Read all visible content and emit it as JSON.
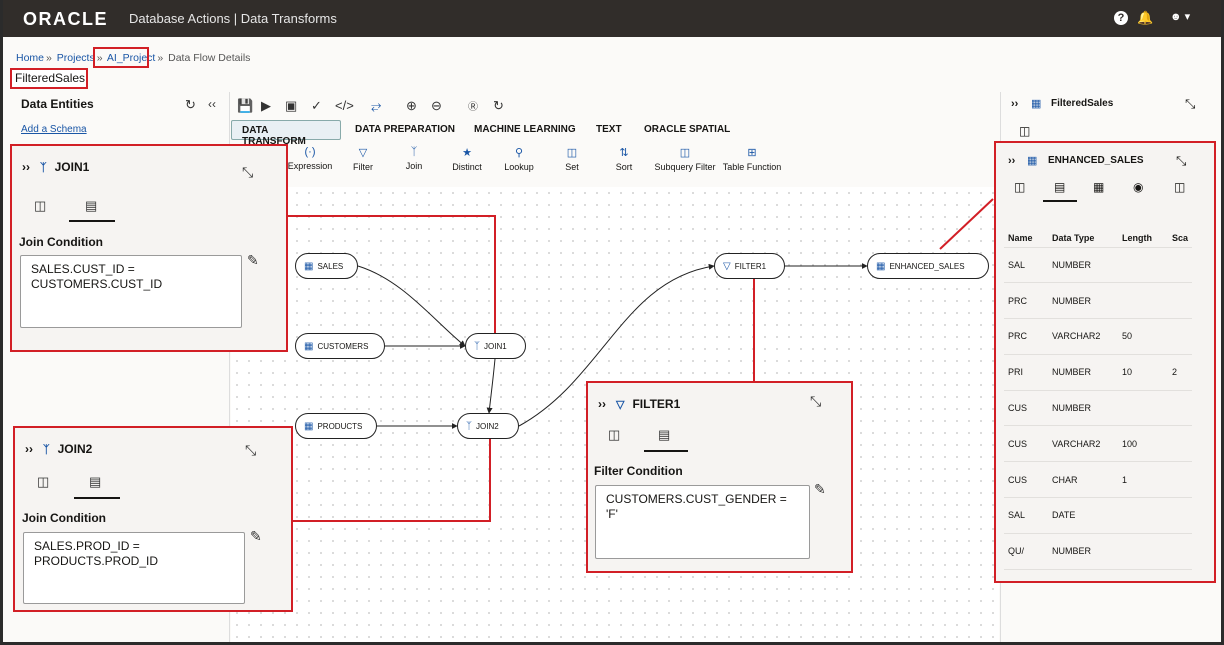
{
  "header": {
    "logo": "ORACLE",
    "app_title": "Database Actions | Data Transforms",
    "help_icon": "?",
    "bell_icon": "bell",
    "user_icon": "user"
  },
  "breadcrumb": {
    "home": "Home",
    "projects": "Projects",
    "project": "AI_Project",
    "current": "Data Flow Details"
  },
  "page_title": "FilteredSales",
  "data_entities": {
    "title": "Data Entities",
    "add_schema": "Add a Schema"
  },
  "tabs": [
    "DATA TRANSFORM",
    "DATA PREPARATION",
    "MACHINE LEARNING",
    "TEXT",
    "ORACLE SPATIAL"
  ],
  "tools": [
    "Expression",
    "Filter",
    "Join",
    "Distinct",
    "Lookup",
    "Set",
    "Sort",
    "Subquery Filter",
    "Table Function"
  ],
  "nodes": {
    "sales": "SALES",
    "customers": "CUSTOMERS",
    "products": "PRODUCTS",
    "join1": "JOIN1",
    "join2": "JOIN2",
    "filter1": "FILTER1",
    "enhanced": "ENHANCED_SALES"
  },
  "right_panel": {
    "title": "FilteredSales"
  },
  "join1": {
    "title": "JOIN1",
    "label": "Join Condition",
    "condition": "SALES.CUST_ID =\nCUSTOMERS.CUST_ID"
  },
  "join2": {
    "title": "JOIN2",
    "label": "Join Condition",
    "condition": "SALES.PROD_ID =\nPRODUCTS.PROD_ID"
  },
  "filter1": {
    "title": "FILTER1",
    "label": "Filter Condition",
    "condition": "CUSTOMERS.CUST_GENDER =\n'F'"
  },
  "enhanced_sales": {
    "title": "ENHANCED_SALES",
    "headers": [
      "Name",
      "Data Type",
      "Length",
      "Sca"
    ],
    "rows": [
      [
        "SAL",
        "NUMBER",
        "",
        ""
      ],
      [
        "PRC",
        "NUMBER",
        "",
        ""
      ],
      [
        "PRC",
        "VARCHAR2",
        "50",
        ""
      ],
      [
        "PRI",
        "NUMBER",
        "10",
        "2"
      ],
      [
        "CUS",
        "NUMBER",
        "",
        ""
      ],
      [
        "CUS",
        "VARCHAR2",
        "100",
        ""
      ],
      [
        "CUS",
        "CHAR",
        "1",
        ""
      ],
      [
        "SAL",
        "DATE",
        "",
        ""
      ],
      [
        "QU/",
        "NUMBER",
        "",
        ""
      ]
    ]
  },
  "colors": {
    "highlight": "#d21f26",
    "header_bg": "#312d2a",
    "link": "#1a56a6"
  }
}
